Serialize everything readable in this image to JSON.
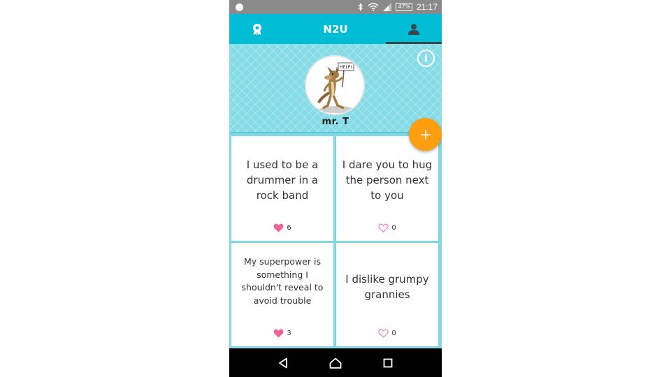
{
  "status_bar": {
    "battery": "47%",
    "time": "21:17",
    "icons": [
      "bluetooth-icon",
      "wifi-icon",
      "signal-icon",
      "battery-icon"
    ]
  },
  "app_bar": {
    "title": "N2U",
    "tabs": [
      {
        "icon": "badge-icon",
        "selected": false
      },
      {
        "icon": "person-icon",
        "selected": true
      }
    ]
  },
  "profile": {
    "username": "mr. T",
    "info_icon": "info-icon",
    "avatar_sign": "HELP!"
  },
  "cards": [
    {
      "text": "I used to be a drummer in a rock band",
      "likes": "6",
      "liked": true
    },
    {
      "text": "I dare you to hug the person next to you",
      "likes": "0",
      "liked": false
    },
    {
      "text": "My superpower is something I shouldn't reveal to avoid trouble",
      "likes": "3",
      "liked": true
    },
    {
      "text": "I dislike grumpy grannies",
      "likes": "0",
      "liked": false
    }
  ],
  "colors": {
    "primary": "#00bcd4",
    "header_bg": "#86dce6",
    "fab": "#ff9f0f",
    "heart": "#f06292"
  },
  "nav_bar": [
    "back-icon",
    "home-icon",
    "recents-icon"
  ]
}
